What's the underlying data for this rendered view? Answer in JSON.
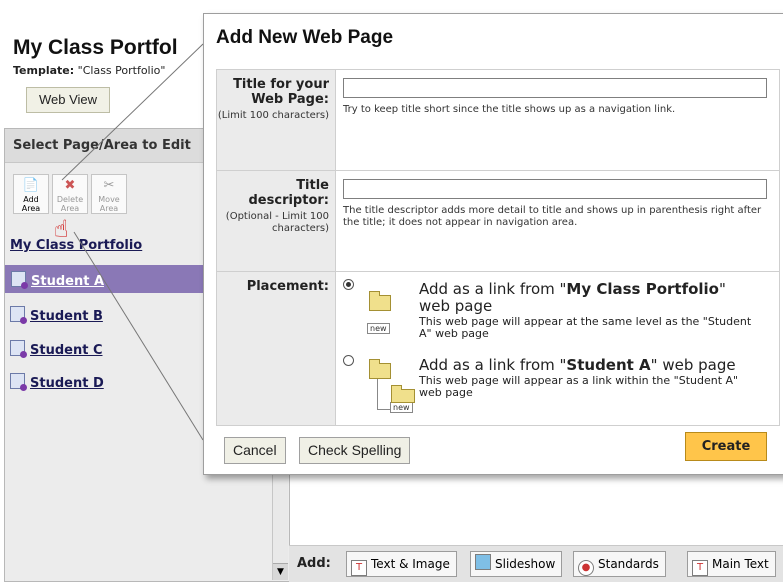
{
  "app": {
    "portfolio_title": "My Class Portfol",
    "template_label": "Template:",
    "template_value": "\"Class Portfolio\"",
    "web_view_button": "Web View",
    "panel_header": "Select Page/Area to Edit",
    "tools": [
      {
        "label": "Add Area",
        "icon": "add-page-icon",
        "enabled": true
      },
      {
        "label": "Delete Area",
        "icon": "delete-page-icon",
        "enabled": false
      },
      {
        "label": "Move Area",
        "icon": "move-page-icon",
        "enabled": false
      }
    ],
    "nav_root": "My Class Portfolio",
    "nav_items": [
      "Student A",
      "Student B",
      "Student C",
      "Student D"
    ],
    "selected_item": "Student A",
    "add_label": "Add:",
    "add_buttons": [
      {
        "label": "Text & Image",
        "icon": "text-image-icon"
      },
      {
        "label": "Slideshow",
        "icon": "slideshow-icon"
      },
      {
        "label": "Standards",
        "icon": "standards-icon"
      },
      {
        "label": "Main Text",
        "icon": "main-text-icon"
      }
    ]
  },
  "dialog": {
    "title": "Add New Web Page",
    "title_field": {
      "label": "Title for your Web Page:",
      "sub": "(Limit 100 characters)",
      "value": "",
      "hint": "Try to keep title short since the title shows up as a navigation link."
    },
    "descriptor_field": {
      "label": "Title descriptor:",
      "sub": "(Optional - Limit 100 characters)",
      "value": "",
      "hint": "The title descriptor adds more detail to title and shows up in parenthesis right after the title; it does not appear in navigation area."
    },
    "placement": {
      "label": "Placement:",
      "options": [
        {
          "prefix": "Add as a link from \"",
          "target": "My Class Portfolio",
          "suffix": "\" web page",
          "desc": "This web page will appear at the same level as the \"Student A\" web page",
          "selected": true
        },
        {
          "prefix": "Add as a link from \"",
          "target": "Student A",
          "suffix": "\" web page",
          "desc": "This web page will appear as a link within the \"Student A\" web page",
          "selected": false
        }
      ],
      "new_badge": "new"
    },
    "buttons": {
      "cancel": "Cancel",
      "check_spelling": "Check Spelling",
      "create": "Create"
    }
  }
}
